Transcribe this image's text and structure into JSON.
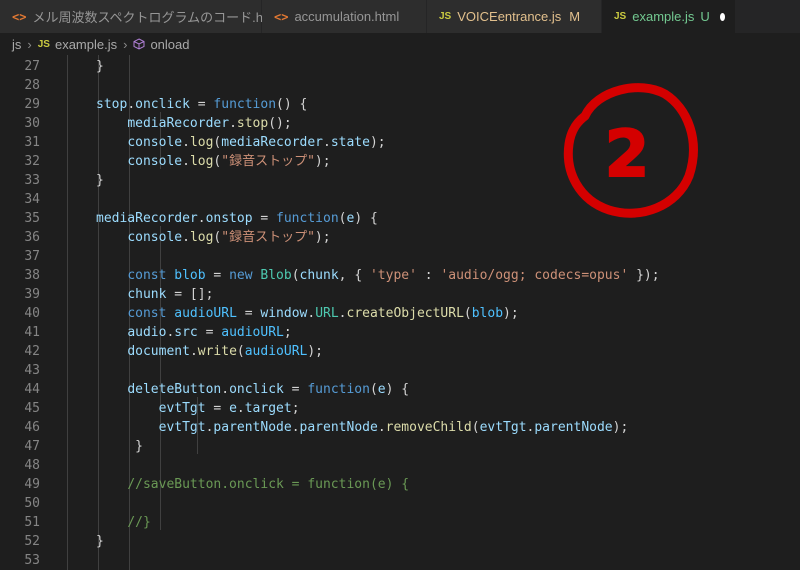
{
  "tabs": [
    {
      "label": "メル周波数スペクトログラムのコード.html",
      "icon": "html-icon",
      "status": ""
    },
    {
      "label": "accumulation.html",
      "icon": "html-icon",
      "status": ""
    },
    {
      "label": "VOICEentrance.js",
      "icon": "js-icon",
      "status": "M"
    },
    {
      "label": "example.js",
      "icon": "js-icon",
      "status": "U",
      "active": true
    }
  ],
  "breadcrumb": {
    "folder": "js",
    "file": "example.js",
    "symbol": "onload",
    "js_badge": "JS"
  },
  "annotation_text": "2",
  "colors": {
    "annotation": "#d40000",
    "background": "#1e1e1e"
  },
  "lines": [
    {
      "n": "27",
      "tokens": [
        {
          "t": "}",
          "c": "pun"
        }
      ]
    },
    {
      "n": "28",
      "tokens": []
    },
    {
      "n": "29",
      "tokens": [
        {
          "t": "stop",
          "c": "var"
        },
        {
          "t": ".",
          "c": "pun"
        },
        {
          "t": "onclick",
          "c": "prop"
        },
        {
          "t": " = ",
          "c": "pun"
        },
        {
          "t": "function",
          "c": "kw"
        },
        {
          "t": "() {",
          "c": "pun"
        }
      ]
    },
    {
      "n": "30",
      "tokens": [
        {
          "t": "    ",
          "c": "pun"
        },
        {
          "t": "mediaRecorder",
          "c": "var"
        },
        {
          "t": ".",
          "c": "pun"
        },
        {
          "t": "stop",
          "c": "fn"
        },
        {
          "t": "();",
          "c": "pun"
        }
      ]
    },
    {
      "n": "31",
      "tokens": [
        {
          "t": "    ",
          "c": "pun"
        },
        {
          "t": "console",
          "c": "var"
        },
        {
          "t": ".",
          "c": "pun"
        },
        {
          "t": "log",
          "c": "fn"
        },
        {
          "t": "(",
          "c": "pun"
        },
        {
          "t": "mediaRecorder",
          "c": "var"
        },
        {
          "t": ".",
          "c": "pun"
        },
        {
          "t": "state",
          "c": "prop"
        },
        {
          "t": ");",
          "c": "pun"
        }
      ]
    },
    {
      "n": "32",
      "tokens": [
        {
          "t": "    ",
          "c": "pun"
        },
        {
          "t": "console",
          "c": "var"
        },
        {
          "t": ".",
          "c": "pun"
        },
        {
          "t": "log",
          "c": "fn"
        },
        {
          "t": "(",
          "c": "pun"
        },
        {
          "t": "\"録音ストップ\"",
          "c": "str"
        },
        {
          "t": ");",
          "c": "pun"
        }
      ]
    },
    {
      "n": "33",
      "tokens": [
        {
          "t": "}",
          "c": "pun"
        }
      ]
    },
    {
      "n": "34",
      "tokens": []
    },
    {
      "n": "35",
      "tokens": [
        {
          "t": "mediaRecorder",
          "c": "var"
        },
        {
          "t": ".",
          "c": "pun"
        },
        {
          "t": "onstop",
          "c": "prop"
        },
        {
          "t": " = ",
          "c": "pun"
        },
        {
          "t": "function",
          "c": "kw"
        },
        {
          "t": "(",
          "c": "pun"
        },
        {
          "t": "e",
          "c": "var"
        },
        {
          "t": ") {",
          "c": "pun"
        }
      ]
    },
    {
      "n": "36",
      "tokens": [
        {
          "t": "    ",
          "c": "pun"
        },
        {
          "t": "console",
          "c": "var"
        },
        {
          "t": ".",
          "c": "pun"
        },
        {
          "t": "log",
          "c": "fn"
        },
        {
          "t": "(",
          "c": "pun"
        },
        {
          "t": "\"録音ストップ\"",
          "c": "str"
        },
        {
          "t": ");",
          "c": "pun"
        }
      ]
    },
    {
      "n": "37",
      "tokens": []
    },
    {
      "n": "38",
      "tokens": [
        {
          "t": "    ",
          "c": "pun"
        },
        {
          "t": "const",
          "c": "kw"
        },
        {
          "t": " ",
          "c": "pun"
        },
        {
          "t": "blob",
          "c": "const"
        },
        {
          "t": " = ",
          "c": "pun"
        },
        {
          "t": "new",
          "c": "kw"
        },
        {
          "t": " ",
          "c": "pun"
        },
        {
          "t": "Blob",
          "c": "cls"
        },
        {
          "t": "(",
          "c": "pun"
        },
        {
          "t": "chunk",
          "c": "var"
        },
        {
          "t": ", { ",
          "c": "pun"
        },
        {
          "t": "'type'",
          "c": "str"
        },
        {
          "t": " : ",
          "c": "pun"
        },
        {
          "t": "'audio/ogg; codecs=opus'",
          "c": "str"
        },
        {
          "t": " });",
          "c": "pun"
        }
      ]
    },
    {
      "n": "39",
      "tokens": [
        {
          "t": "    ",
          "c": "pun"
        },
        {
          "t": "chunk",
          "c": "var"
        },
        {
          "t": " = [];",
          "c": "pun"
        }
      ]
    },
    {
      "n": "40",
      "tokens": [
        {
          "t": "    ",
          "c": "pun"
        },
        {
          "t": "const",
          "c": "kw"
        },
        {
          "t": " ",
          "c": "pun"
        },
        {
          "t": "audioURL",
          "c": "const"
        },
        {
          "t": " = ",
          "c": "pun"
        },
        {
          "t": "window",
          "c": "var"
        },
        {
          "t": ".",
          "c": "pun"
        },
        {
          "t": "URL",
          "c": "cls"
        },
        {
          "t": ".",
          "c": "pun"
        },
        {
          "t": "createObjectURL",
          "c": "fn"
        },
        {
          "t": "(",
          "c": "pun"
        },
        {
          "t": "blob",
          "c": "const"
        },
        {
          "t": ");",
          "c": "pun"
        }
      ]
    },
    {
      "n": "41",
      "tokens": [
        {
          "t": "    ",
          "c": "pun"
        },
        {
          "t": "audio",
          "c": "var"
        },
        {
          "t": ".",
          "c": "pun"
        },
        {
          "t": "src",
          "c": "prop"
        },
        {
          "t": " = ",
          "c": "pun"
        },
        {
          "t": "audioURL",
          "c": "const"
        },
        {
          "t": ";",
          "c": "pun"
        }
      ]
    },
    {
      "n": "42",
      "tokens": [
        {
          "t": "    ",
          "c": "pun"
        },
        {
          "t": "document",
          "c": "var"
        },
        {
          "t": ".",
          "c": "pun"
        },
        {
          "t": "write",
          "c": "fn"
        },
        {
          "t": "(",
          "c": "pun"
        },
        {
          "t": "audioURL",
          "c": "const"
        },
        {
          "t": ");",
          "c": "pun"
        }
      ]
    },
    {
      "n": "43",
      "tokens": []
    },
    {
      "n": "44",
      "tokens": [
        {
          "t": "    ",
          "c": "pun"
        },
        {
          "t": "deleteButton",
          "c": "var"
        },
        {
          "t": ".",
          "c": "pun"
        },
        {
          "t": "onclick",
          "c": "prop"
        },
        {
          "t": " = ",
          "c": "pun"
        },
        {
          "t": "function",
          "c": "kw"
        },
        {
          "t": "(",
          "c": "pun"
        },
        {
          "t": "e",
          "c": "var"
        },
        {
          "t": ") {",
          "c": "pun"
        }
      ]
    },
    {
      "n": "45",
      "tokens": [
        {
          "t": "        ",
          "c": "pun"
        },
        {
          "t": "evtTgt",
          "c": "var"
        },
        {
          "t": " = ",
          "c": "pun"
        },
        {
          "t": "e",
          "c": "var"
        },
        {
          "t": ".",
          "c": "pun"
        },
        {
          "t": "target",
          "c": "prop"
        },
        {
          "t": ";",
          "c": "pun"
        }
      ]
    },
    {
      "n": "46",
      "tokens": [
        {
          "t": "        ",
          "c": "pun"
        },
        {
          "t": "evtTgt",
          "c": "var"
        },
        {
          "t": ".",
          "c": "pun"
        },
        {
          "t": "parentNode",
          "c": "prop"
        },
        {
          "t": ".",
          "c": "pun"
        },
        {
          "t": "parentNode",
          "c": "prop"
        },
        {
          "t": ".",
          "c": "pun"
        },
        {
          "t": "removeChild",
          "c": "fn"
        },
        {
          "t": "(",
          "c": "pun"
        },
        {
          "t": "evtTgt",
          "c": "var"
        },
        {
          "t": ".",
          "c": "pun"
        },
        {
          "t": "parentNode",
          "c": "prop"
        },
        {
          "t": ");",
          "c": "pun"
        }
      ]
    },
    {
      "n": "47",
      "tokens": [
        {
          "t": "     }",
          "c": "pun"
        }
      ]
    },
    {
      "n": "48",
      "tokens": []
    },
    {
      "n": "49",
      "tokens": [
        {
          "t": "    ",
          "c": "pun"
        },
        {
          "t": "//saveButton.onclick = function(e) {",
          "c": "com"
        }
      ]
    },
    {
      "n": "50",
      "tokens": []
    },
    {
      "n": "51",
      "tokens": [
        {
          "t": "    ",
          "c": "pun"
        },
        {
          "t": "//}",
          "c": "com"
        }
      ]
    },
    {
      "n": "52",
      "tokens": [
        {
          "t": "}",
          "c": "pun"
        }
      ]
    },
    {
      "n": "53",
      "tokens": []
    }
  ]
}
